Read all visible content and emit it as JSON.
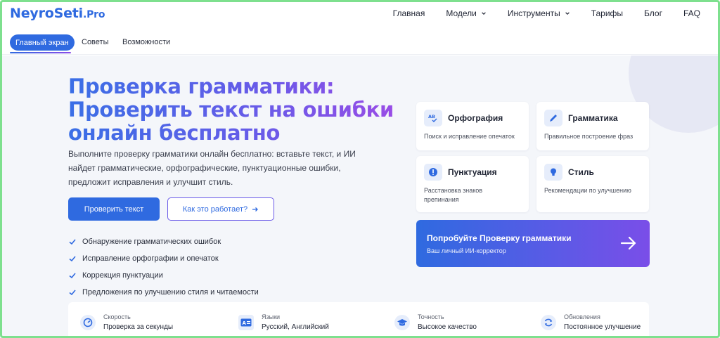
{
  "header": {
    "logo_main": "NeyroSeti",
    "logo_suffix": ".Pro",
    "nav": [
      {
        "label": "Главная"
      },
      {
        "label": "Модели",
        "has_dropdown": true
      },
      {
        "label": "Инструменты",
        "has_dropdown": true
      },
      {
        "label": "Тарифы"
      },
      {
        "label": "Блог"
      },
      {
        "label": "FAQ"
      }
    ]
  },
  "subnav": {
    "active": "Главный экран",
    "links": [
      "Советы",
      "Возможности"
    ]
  },
  "hero": {
    "title_line1": "Проверка грамматики:",
    "title_line2": "Проверить текст на ошибки",
    "title_line3": "онлайн бесплатно",
    "description": "Выполните проверку грамматики онлайн бесплатно: вставьте текст, и ИИ найдет грамматические, орфографические, пунктуационные ошибки, предложит исправления и улучшит стиль.",
    "primary_button": "Проверить текст",
    "secondary_button": "Как это работает?",
    "features": [
      "Обнаружение грамматических ошибок",
      "Исправление орфографии и опечаток",
      "Коррекция пунктуации",
      "Предложения по улучшению стиля и читаемости"
    ]
  },
  "cards": [
    {
      "title": "Орфография",
      "desc": "Поиск и исправление опечаток",
      "icon": "spellcheck-icon"
    },
    {
      "title": "Грамматика",
      "desc": "Правильное построение фраз",
      "icon": "pencil-icon"
    },
    {
      "title": "Пунктуация",
      "desc": "Расстановка знаков препинания",
      "icon": "exclamation-icon"
    },
    {
      "title": "Стиль",
      "desc": "Рекомендации по улучшению",
      "icon": "lightbulb-icon"
    }
  ],
  "promo": {
    "title": "Попробуйте Проверку грамматики",
    "subtitle": "Ваш личный ИИ-корректор"
  },
  "stats": [
    {
      "label": "Скорость",
      "value": "Проверка за секунды",
      "icon": "speedometer-icon"
    },
    {
      "label": "Языки",
      "value": "Русский, Английский",
      "icon": "translate-icon"
    },
    {
      "label": "Точность",
      "value": "Высокое качество",
      "icon": "graduation-cap-icon"
    },
    {
      "label": "Обновления",
      "value": "Постоянное улучшение",
      "icon": "refresh-icon"
    }
  ],
  "colors": {
    "accent": "#2f6ae0",
    "accent_purple": "#7a4ee8",
    "background": "#f4f6fa",
    "frame": "#7ee08e"
  }
}
